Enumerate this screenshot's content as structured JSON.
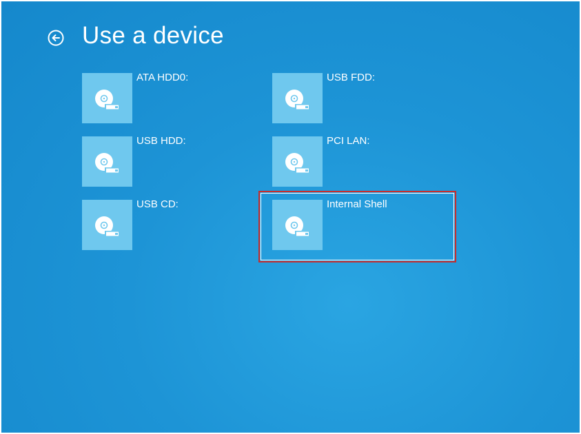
{
  "header": {
    "title": "Use a device",
    "back_icon": "back-arrow-circle-icon"
  },
  "devices": [
    {
      "label": "ATA HDD0:",
      "icon": "disk-drive-icon"
    },
    {
      "label": "USB FDD:",
      "icon": "disk-drive-icon"
    },
    {
      "label": "USB HDD:",
      "icon": "disk-drive-icon"
    },
    {
      "label": "PCI LAN:",
      "icon": "disk-drive-icon"
    },
    {
      "label": "USB CD:",
      "icon": "disk-drive-icon"
    },
    {
      "label": "Internal Shell",
      "icon": "disk-drive-icon",
      "selected": true
    }
  ],
  "colors": {
    "background": "#1d94d6",
    "tile": "#6fc8ee",
    "highlight": "#c62d2d"
  }
}
